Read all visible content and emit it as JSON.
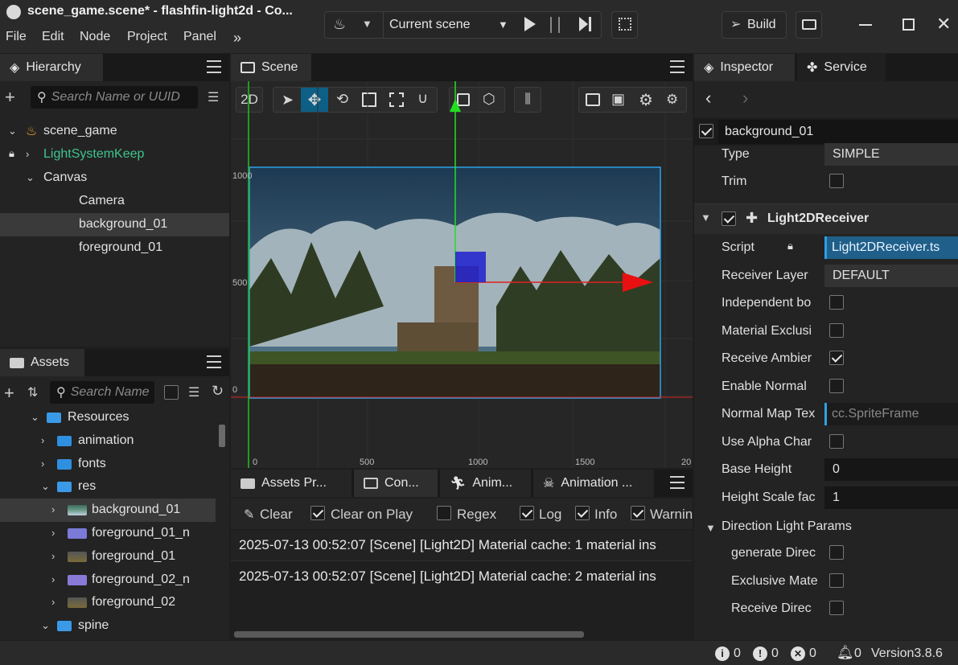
{
  "window": {
    "title": "scene_game.scene* - flashfin-light2d - Co...",
    "menu": [
      "File",
      "Edit",
      "Node",
      "Project",
      "Panel"
    ],
    "scene_select": "Current scene",
    "build_label": "Build"
  },
  "hierarchy": {
    "tab": "Hierarchy",
    "search_placeholder": "Search Name or UUID",
    "nodes": [
      {
        "label": "scene_game",
        "depth": 0,
        "expanded": true,
        "icon": "fire-icon"
      },
      {
        "label": "LightSystemKeep",
        "depth": 1,
        "expanded": false,
        "color": "#3fc48e",
        "locked": true
      },
      {
        "label": "Canvas",
        "depth": 1,
        "expanded": true
      },
      {
        "label": "Camera",
        "depth": 2
      },
      {
        "label": "background_01",
        "depth": 2,
        "selected": true
      },
      {
        "label": "foreground_01",
        "depth": 2
      }
    ]
  },
  "assets": {
    "tab": "Assets",
    "search_placeholder": "Search Name",
    "items": [
      {
        "label": "Resources",
        "depth": 0,
        "expanded": true,
        "type": "folder-open"
      },
      {
        "label": "animation",
        "depth": 1,
        "type": "folder"
      },
      {
        "label": "fonts",
        "depth": 1,
        "type": "folder"
      },
      {
        "label": "res",
        "depth": 1,
        "expanded": true,
        "type": "folder-open"
      },
      {
        "label": "background_01",
        "depth": 2,
        "type": "image",
        "selected": true
      },
      {
        "label": "foreground_01_n",
        "depth": 2,
        "type": "image"
      },
      {
        "label": "foreground_01",
        "depth": 2,
        "type": "image"
      },
      {
        "label": "foreground_02_n",
        "depth": 2,
        "type": "image"
      },
      {
        "label": "foreground_02",
        "depth": 2,
        "type": "image"
      },
      {
        "label": "spine",
        "depth": 1,
        "expanded": true,
        "type": "folder-open"
      }
    ]
  },
  "scene": {
    "tab": "Scene",
    "mode_2d": "2D",
    "y_ticks": [
      "1000",
      "500",
      "0"
    ],
    "x_ticks": [
      "0",
      "500",
      "1000",
      "1500",
      "20"
    ]
  },
  "bottom": {
    "tabs": [
      "Assets Pr...",
      "Con...",
      "Anim...",
      "Animation ..."
    ],
    "toolbar": {
      "clear": "Clear",
      "clear_on_play": "Clear on Play",
      "regex": "Regex",
      "log": "Log",
      "info": "Info",
      "warning": "Warnin"
    },
    "lines": [
      "2025-07-13 00:52:07 [Scene] [Light2D] Material cache: 1 material ins",
      "2025-07-13 00:52:07 [Scene] [Light2D] Material cache: 2 material ins"
    ]
  },
  "inspector": {
    "tabs": [
      "Inspector",
      "Service"
    ],
    "node_name": "background_01",
    "type_label": "Type",
    "type_value": "SIMPLE",
    "trim_label": "Trim",
    "component": "Light2DReceiver",
    "props": [
      {
        "label": "Script",
        "value": "Light2DReceiver.ts",
        "kind": "asset"
      },
      {
        "label": "Receiver Layer",
        "value": "DEFAULT",
        "kind": "select"
      },
      {
        "label": "Independent bo",
        "kind": "check",
        "on": false
      },
      {
        "label": "Material Exclusi",
        "kind": "check",
        "on": false
      },
      {
        "label": "Receive Ambier",
        "kind": "check",
        "on": true
      },
      {
        "label": "Enable Normal",
        "kind": "check",
        "on": false
      },
      {
        "label": "Normal Map Tex",
        "value": "cc.SpriteFrame",
        "kind": "asset-empty"
      },
      {
        "label": "Use Alpha Char",
        "kind": "check",
        "on": false
      },
      {
        "label": "Base Height",
        "value": "0",
        "kind": "number"
      },
      {
        "label": "Height Scale fac",
        "value": "1",
        "kind": "number"
      }
    ],
    "group": "Direction Light Params",
    "group_props": [
      {
        "label": "generate Direc",
        "on": false
      },
      {
        "label": "Exclusive Mate",
        "on": false
      },
      {
        "label": "Receive Direc",
        "on": false
      }
    ]
  },
  "status": {
    "info": "0",
    "warn": "0",
    "error": "0",
    "bell": "0",
    "version": "Version3.8.6"
  }
}
